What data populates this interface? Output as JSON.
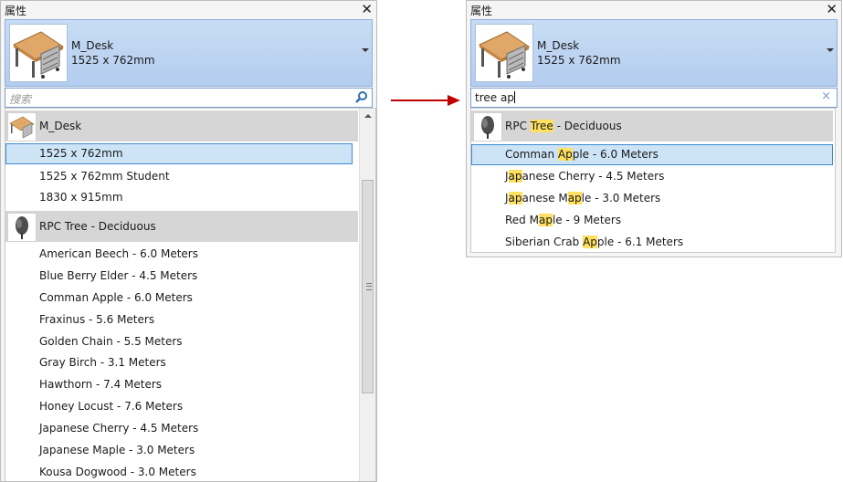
{
  "left_panel": {
    "title": "属性",
    "close_glyph": "✕",
    "selector": {
      "name": "M_Desk",
      "size": "1525 x 762mm"
    },
    "search": {
      "value": "",
      "placeholder": "搜索"
    },
    "groups": [
      {
        "name": "M_Desk",
        "icon": "desk-icon",
        "items": [
          "1525 x 762mm",
          "1525 x 762mm Student",
          "1830 x 915mm"
        ]
      },
      {
        "name": "RPC Tree - Deciduous",
        "icon": "tree-icon",
        "items": [
          "American Beech - 6.0 Meters",
          "Blue Berry Elder - 4.5 Meters",
          "Comman Apple - 6.0 Meters",
          "Fraxinus - 5.6 Meters",
          "Golden Chain - 5.5 Meters",
          "Gray Birch - 3.1 Meters",
          "Hawthorn - 7.4 Meters",
          "Honey Locust - 7.6 Meters",
          "Japanese Cherry - 4.5 Meters",
          "Japanese Maple - 3.0 Meters",
          "Kousa Dogwood - 3.0 Meters"
        ]
      }
    ],
    "selected_item": "1525 x 762mm"
  },
  "right_panel": {
    "title": "属性",
    "close_glyph": "✕",
    "selector": {
      "name": "M_Desk",
      "size": "1525 x 762mm"
    },
    "search": {
      "value": "tree ap",
      "clear_glyph": "×"
    },
    "group": {
      "prefix": "RPC ",
      "match": "Tree",
      "suffix": " - Deciduous",
      "icon": "tree-icon"
    },
    "items": [
      {
        "pre": "Comman ",
        "match": "Ap",
        "post": "ple - 6.0 Meters"
      },
      {
        "pre": "J",
        "match": "ap",
        "post": "anese Cherry - 4.5 Meters"
      },
      {
        "pre": "J",
        "match": "ap",
        "post": "anese Maple - 3.0 Meters",
        "second_match": true
      },
      {
        "pre": "Red M",
        "match": "ap",
        "post": "le - 9 Meters"
      },
      {
        "pre": "Siberian Crab ",
        "match": "Ap",
        "post": "ple - 6.1 Meters"
      }
    ],
    "selected_index": 0
  },
  "colors": {
    "accent": "#3d8ad0",
    "highlight": "#ffe060",
    "arrow": "#c00000"
  }
}
